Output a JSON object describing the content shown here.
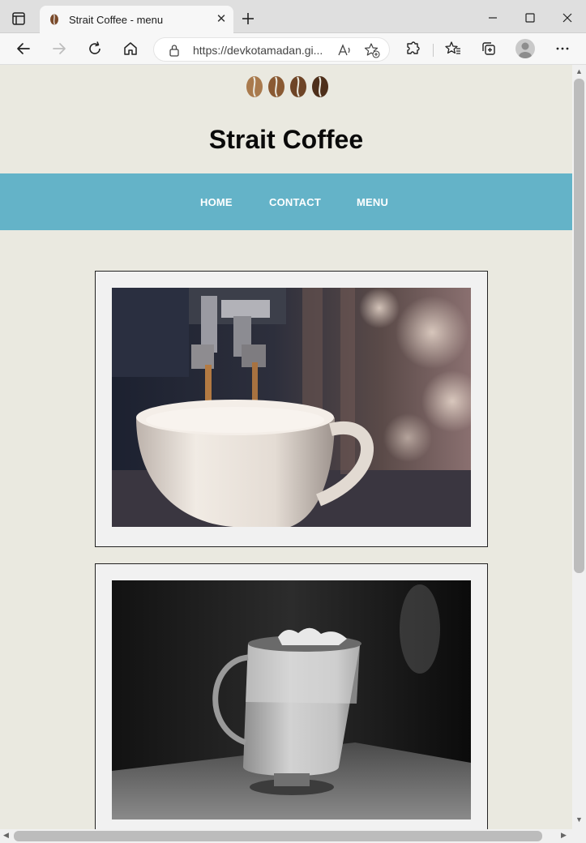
{
  "browser": {
    "tab_title": "Strait Coffee - menu",
    "tab_close": "✕",
    "address": "https://devkotamadan.gi...",
    "icons": [
      "tab-actions-icon",
      "coffee-bean-favicon",
      "new-tab-icon",
      "minimize-icon",
      "maximize-icon",
      "close-window-icon",
      "back-icon",
      "forward-icon",
      "refresh-icon",
      "home-icon",
      "lock-icon",
      "read-aloud-icon",
      "add-favorite-icon",
      "extensions-icon",
      "favorites-icon",
      "collections-icon",
      "profile-icon",
      "more-icon"
    ]
  },
  "page": {
    "site_title": "Strait Coffee",
    "nav": [
      "HOME",
      "CONTACT",
      "MENU"
    ],
    "colors": {
      "background": "#eae9e0",
      "nav": "#64b3c8",
      "card": "#f1f1f1",
      "logo": "#8a5a33"
    }
  },
  "scrollbars": {
    "up": "▲",
    "down": "▼",
    "left": "◀",
    "right": "▶"
  }
}
